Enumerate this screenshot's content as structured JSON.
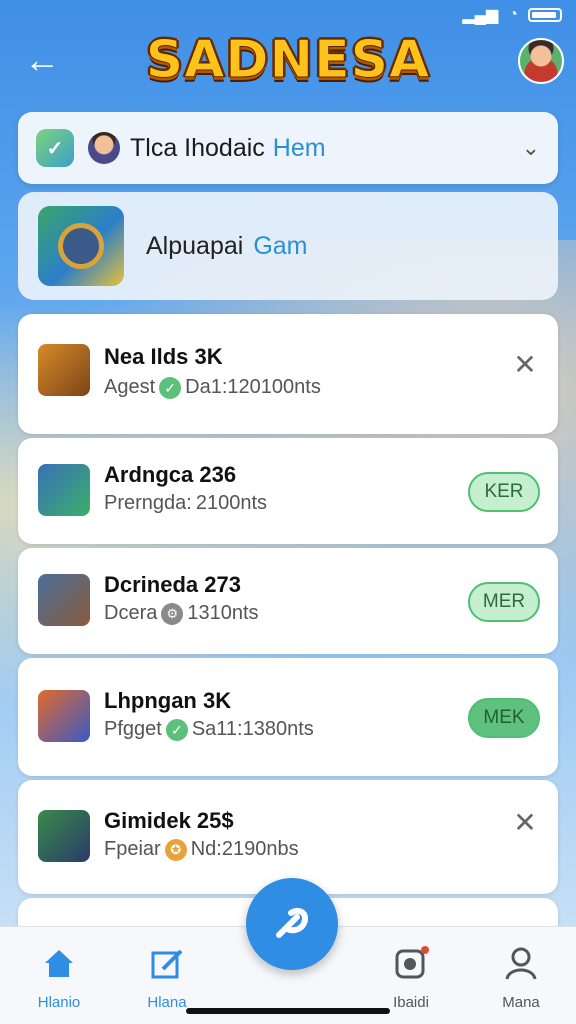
{
  "app": {
    "title": "SADNESA"
  },
  "status_bar": {
    "signal_icon": "signal-icon",
    "wifi_icon": "wifi-icon",
    "battery_icon": "battery-icon"
  },
  "selector": {
    "label": "Tlca Ihodaic",
    "accent": "Hem"
  },
  "game": {
    "name": "Alpuapai",
    "accent": "Gam"
  },
  "items": [
    {
      "title": "Nea Ilds 3K",
      "sub_prefix": "Agest",
      "sub_rest": "Da1:120100nts",
      "badge": "check",
      "action": "close",
      "action_label": ""
    },
    {
      "title": "Ardngca 236",
      "sub_prefix": "Prerngda:",
      "sub_rest": "2100nts",
      "badge": "",
      "action": "button",
      "action_label": "KER"
    },
    {
      "title": "Dcrineda 273",
      "sub_prefix": "Dcera",
      "sub_rest": "1310nts",
      "badge": "gray",
      "action": "button",
      "action_label": "MER"
    },
    {
      "title": "Lhpngan 3K",
      "sub_prefix": "Pfgget",
      "sub_rest": "Sa11:1380nts",
      "badge": "check",
      "action": "button",
      "action_label": "MEK"
    },
    {
      "title": "Gimidek 25$",
      "sub_prefix": "Fpeiar",
      "sub_rest": "Nd:2190nbs",
      "badge": "coin",
      "action": "close",
      "action_label": ""
    }
  ],
  "nav": [
    {
      "label": "Hlanio",
      "icon": "home-icon"
    },
    {
      "label": "Hlana",
      "icon": "edit-icon"
    },
    {
      "label": "Ibaidi",
      "icon": "camera-icon"
    },
    {
      "label": "Mana",
      "icon": "user-icon"
    }
  ],
  "colors": {
    "primary": "#2f8de4",
    "accent": "#2c8fd6",
    "success": "#4fbf73",
    "title_gold": "#ffc21a"
  }
}
